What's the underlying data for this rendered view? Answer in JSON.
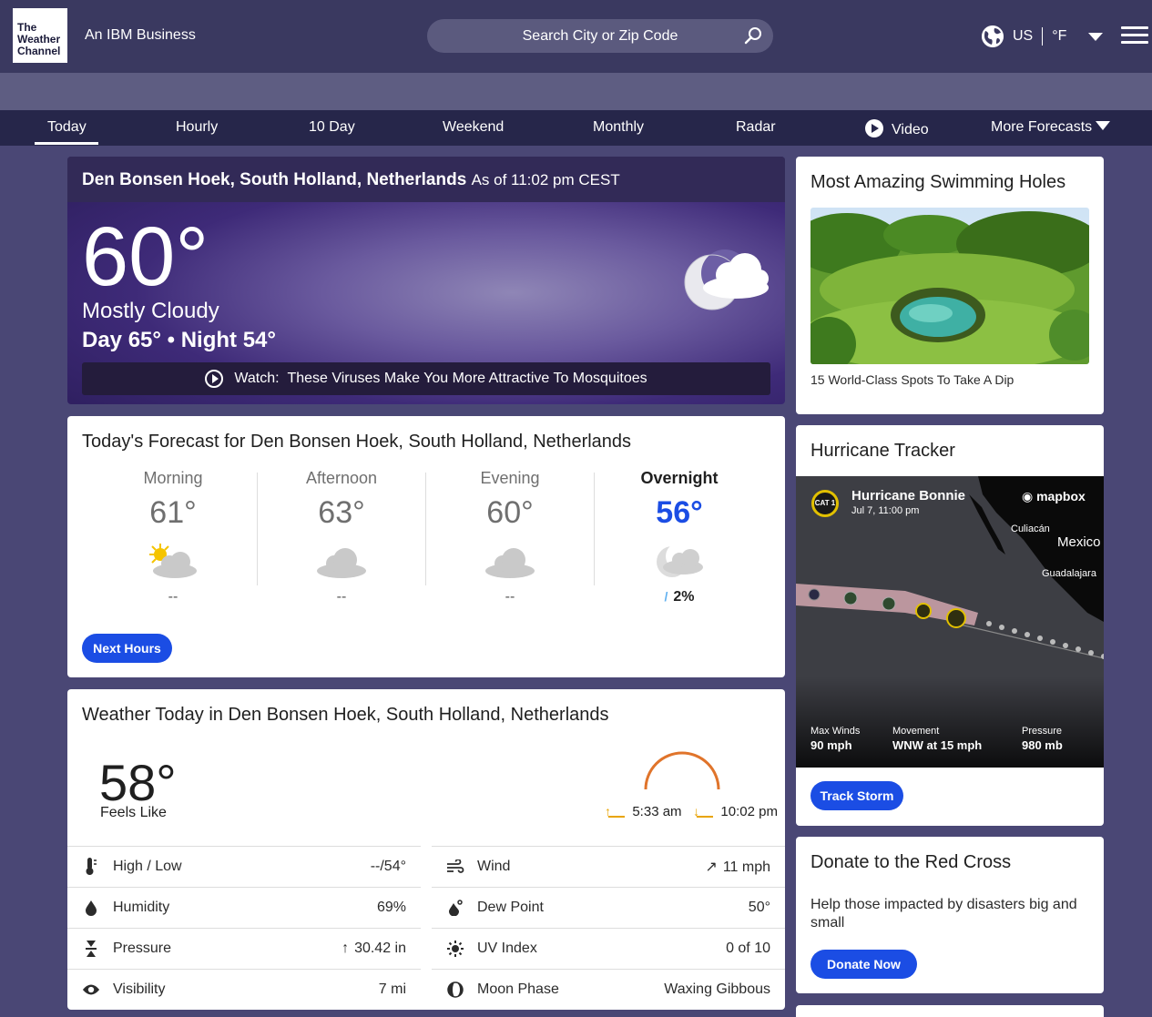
{
  "header": {
    "logo_text": "The Weather Channel",
    "tagline": "An IBM Business",
    "search_placeholder": "Search City or Zip Code",
    "region": "US",
    "unit": "°F"
  },
  "nav": {
    "items": [
      "Today",
      "Hourly",
      "10 Day",
      "Weekend",
      "Monthly",
      "Radar",
      "Video",
      "More Forecasts"
    ],
    "active": "Today"
  },
  "current": {
    "location": "Den Bonsen Hoek, South Holland, Netherlands",
    "as_of": "As of 11:02 pm CEST",
    "temperature": "60°",
    "condition": "Mostly Cloudy",
    "day_night": "Day 65° • Night 54°",
    "watch_label": "Watch:",
    "watch_title": "These Viruses Make You More Attractive To Mosquitoes"
  },
  "todays_forecast": {
    "title": "Today's Forecast for Den Bonsen Hoek, South Holland, Netherlands",
    "periods": [
      {
        "name": "Morning",
        "temp": "61°",
        "precip": "--",
        "icon": "partly-sunny-icon"
      },
      {
        "name": "Afternoon",
        "temp": "63°",
        "precip": "--",
        "icon": "cloudy-icon"
      },
      {
        "name": "Evening",
        "temp": "60°",
        "precip": "--",
        "icon": "cloudy-icon"
      },
      {
        "name": "Overnight",
        "temp": "56°",
        "precip": "2%",
        "icon": "night-cloudy-icon"
      }
    ],
    "button": "Next Hours"
  },
  "weather_today": {
    "title": "Weather Today in Den Bonsen Hoek, South Holland, Netherlands",
    "feels_like_temp": "58°",
    "feels_like_label": "Feels Like",
    "sunrise": "5:33 am",
    "sunset": "10:02 pm",
    "details": [
      {
        "label": "High / Low",
        "value": "--/54°",
        "icon": "thermometer-icon"
      },
      {
        "label": "Wind",
        "value": "11 mph",
        "icon": "wind-icon"
      },
      {
        "label": "Humidity",
        "value": "69%",
        "icon": "humidity-icon"
      },
      {
        "label": "Dew Point",
        "value": "50°",
        "icon": "dew-point-icon"
      },
      {
        "label": "Pressure",
        "value": "30.42 in",
        "icon": "pressure-icon"
      },
      {
        "label": "UV Index",
        "value": "0 of 10",
        "icon": "uv-icon"
      },
      {
        "label": "Visibility",
        "value": "7 mi",
        "icon": "visibility-icon"
      },
      {
        "label": "Moon Phase",
        "value": "Waxing Gibbous",
        "icon": "moon-phase-icon"
      }
    ]
  },
  "sidebar": {
    "promo": {
      "title": "Most Amazing Swimming Holes",
      "caption": "15 World-Class Spots To Take A Dip"
    },
    "hurricane": {
      "title": "Hurricane Tracker",
      "storm_name": "Hurricane Bonnie",
      "storm_time": "Jul 7, 11:00 pm",
      "category": "CAT 1",
      "map_brand": "mapbox",
      "map_labels": [
        "Culiacán",
        "Mexico",
        "Guadalajara"
      ],
      "max_winds_label": "Max Winds",
      "max_winds": "90 mph",
      "movement_label": "Movement",
      "movement": "WNW at 15 mph",
      "pressure_label": "Pressure",
      "pressure": "980 mb",
      "button": "Track Storm"
    },
    "donate": {
      "title": "Donate to the Red Cross",
      "description": "Help those impacted by disasters big and small",
      "button": "Donate Now"
    }
  }
}
